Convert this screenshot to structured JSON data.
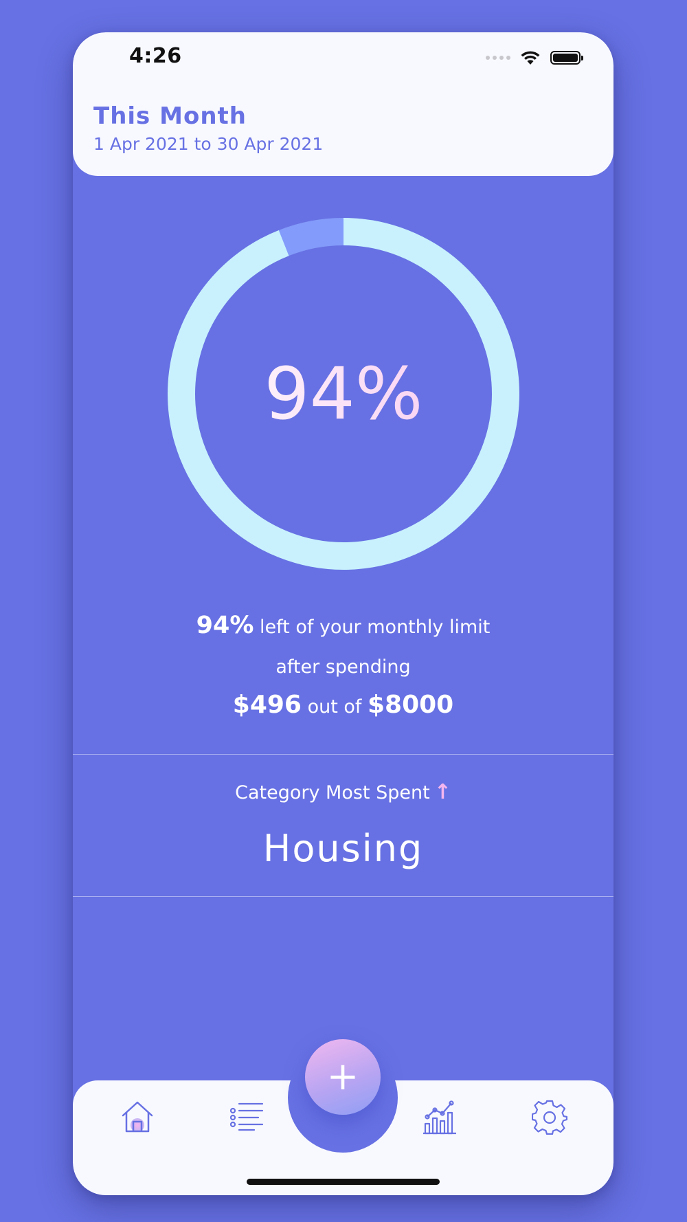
{
  "status_bar": {
    "time": "4:26"
  },
  "header": {
    "title": "This Month",
    "date_range": "1 Apr 2021 to 30 Apr 2021"
  },
  "ring": {
    "percent_label": "94%",
    "remaining_fraction": 0.94,
    "spent_fraction": 0.06,
    "remaining_color": "#c8f1fd",
    "spent_color": "#839bfa"
  },
  "summary": {
    "percent": "94%",
    "line1_rest": "left of your monthly limit",
    "line2": "after spending",
    "spent": "$496",
    "out_of": "out of",
    "limit": "$8000"
  },
  "category": {
    "label": "Category Most Spent",
    "arrow_icon": "arrow-up-icon",
    "value": "Housing"
  },
  "bottom_nav": {
    "items": [
      {
        "icon": "home-icon",
        "active": true
      },
      {
        "icon": "list-icon",
        "active": false
      },
      {
        "icon": "add-icon",
        "label": "+"
      },
      {
        "icon": "stats-chart-icon",
        "active": false
      },
      {
        "icon": "settings-gear-icon",
        "active": false
      }
    ]
  },
  "colors": {
    "background": "#6771e3",
    "card": "#f8f9fe",
    "accent_pink": "#f4b5ee"
  }
}
